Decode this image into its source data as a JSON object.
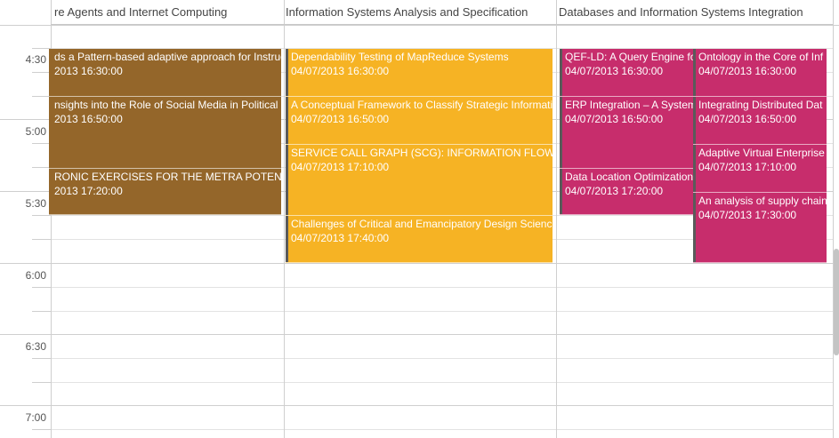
{
  "columns": [
    {
      "header": "re Agents and Internet Computing"
    },
    {
      "header": "Information Systems Analysis and Specification"
    },
    {
      "header": "Databases and Information Systems Integration"
    }
  ],
  "time_labels": [
    "4:30",
    "5:00",
    "5:30",
    "6:00",
    "6:30",
    "7:00"
  ],
  "colors": {
    "brown": "#94662a",
    "orange": "#f6b324",
    "pink": "#c72d6c",
    "accent_bar": "#5a5a5a"
  },
  "events": [
    {
      "title": "ds a Pattern-based adaptive approach for Instructi",
      "time": "2013 16:30:00",
      "color": "brown"
    },
    {
      "title": "nsights into the Role of Social Media in Political (",
      "time": "2013 16:50:00",
      "color": "brown"
    },
    {
      "title": "RONIC EXERCISES FOR THE  METRA POTENTIAL M",
      "time": "2013 17:20:00",
      "color": "brown"
    },
    {
      "title": "Dependability Testing of MapReduce Systems",
      "time": "04/07/2013 16:30:00",
      "color": "orange"
    },
    {
      "title": "A Conceptual Framework to Classify Strategic Informati",
      "time": "04/07/2013 16:50:00",
      "color": "orange"
    },
    {
      "title": "SERVICE CALL GRAPH (SCG): INFORMATION FLOW ANA",
      "time": "04/07/2013 17:10:00",
      "color": "orange"
    },
    {
      "title": "Challenges of Critical and Emancipatory Design Science",
      "time": "04/07/2013 17:40:00",
      "color": "orange"
    },
    {
      "title": "QEF-LD: A Query Engine fo",
      "time": "04/07/2013 16:30:00",
      "color": "pink"
    },
    {
      "title": "ERP Integration – A System",
      "time": "04/07/2013 16:50:00",
      "color": "pink"
    },
    {
      "title": "Data Location Optimization",
      "time": "04/07/2013 17:20:00",
      "color": "pink"
    },
    {
      "title": "Ontology in the Core of Inf",
      "time": "04/07/2013 16:30:00",
      "color": "pink"
    },
    {
      "title": "Integrating Distributed Dat",
      "time": "04/07/2013 16:50:00",
      "color": "pink"
    },
    {
      "title": "Adaptive Virtual Enterprise",
      "time": "04/07/2013 17:10:00",
      "color": "pink"
    },
    {
      "title": "An analysis of supply chain",
      "time": "04/07/2013 17:30:00",
      "color": "pink"
    }
  ]
}
